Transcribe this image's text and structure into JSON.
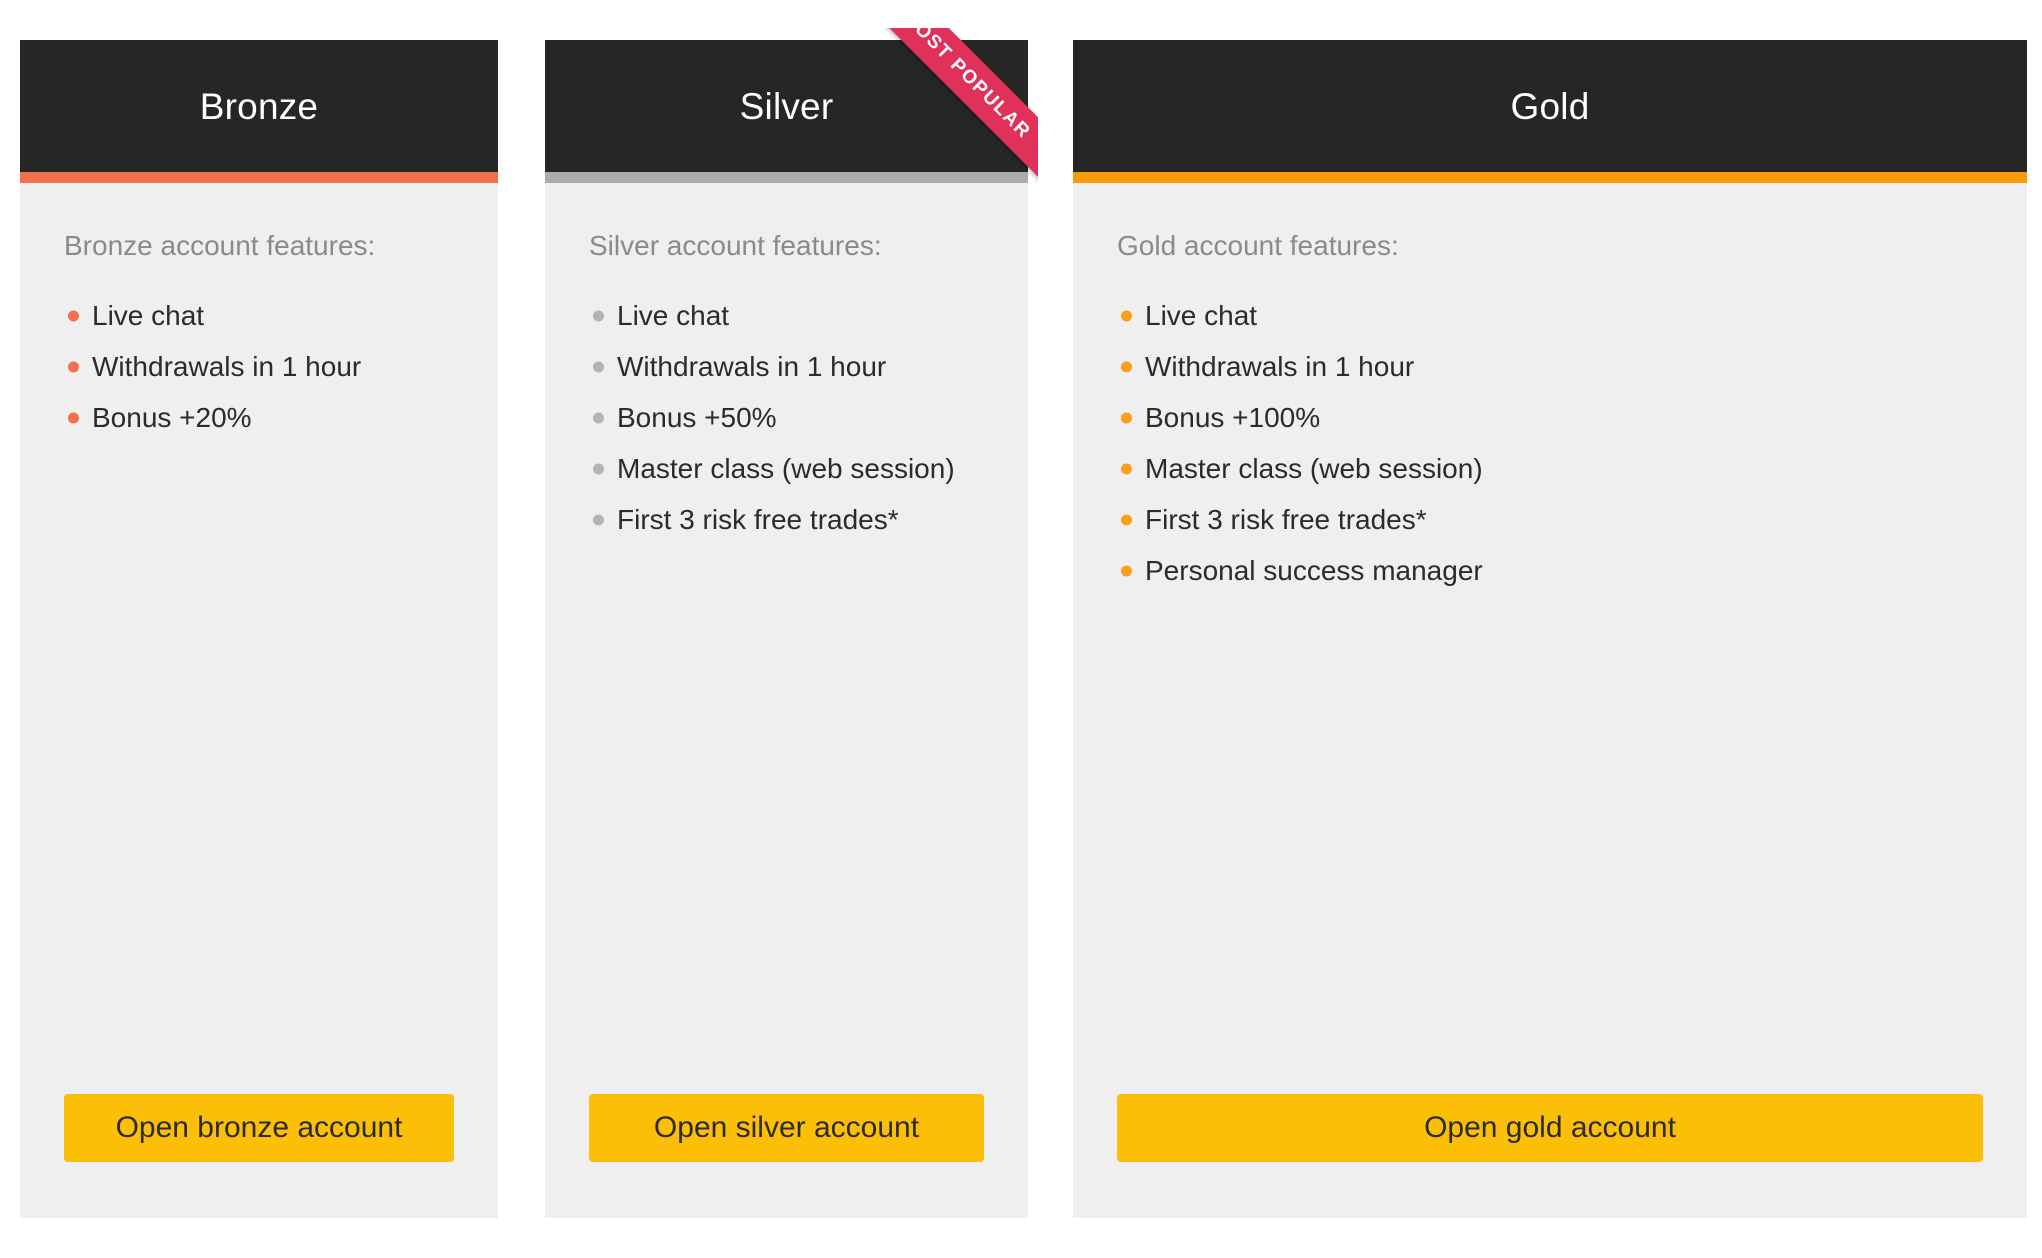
{
  "colors": {
    "header_bg": "#262626",
    "card_bg": "#efefef",
    "page_bg": "#ffffff",
    "button_bg": "#fcbf07",
    "button_text": "#2b2b2b",
    "heading_text": "#8a8a8a",
    "feature_text": "#2b2b2b",
    "ribbon_bg": "#e0315b",
    "ribbon_text": "#ffffff",
    "accent_bronze": "#f3704e",
    "accent_silver": "#acacac",
    "accent_gold": "#f89c0a",
    "bullet_bronze": "#f3704e",
    "bullet_silver": "#b3b3b3",
    "bullet_gold": "#f9a01b"
  },
  "plans": [
    {
      "id": "bronze",
      "title": "Bronze",
      "features_heading": "Bronze account features:",
      "features": [
        "Live chat",
        "Withdrawals in 1 hour",
        "Bonus +20%"
      ],
      "cta_label": "Open bronze account",
      "badge": null
    },
    {
      "id": "silver",
      "title": "Silver",
      "features_heading": "Silver account features:",
      "features": [
        "Live chat",
        "Withdrawals in 1 hour",
        "Bonus +50%",
        "Master class (web session)",
        "First 3 risk free trades*"
      ],
      "cta_label": "Open silver account",
      "badge": "MOST POPULAR"
    },
    {
      "id": "gold",
      "title": "Gold",
      "features_heading": "Gold account features:",
      "features": [
        "Live chat",
        "Withdrawals in 1 hour",
        "Bonus +100%",
        "Master class (web session)",
        "First 3 risk free trades*",
        "Personal success manager"
      ],
      "cta_label": "Open gold account",
      "badge": null
    }
  ]
}
